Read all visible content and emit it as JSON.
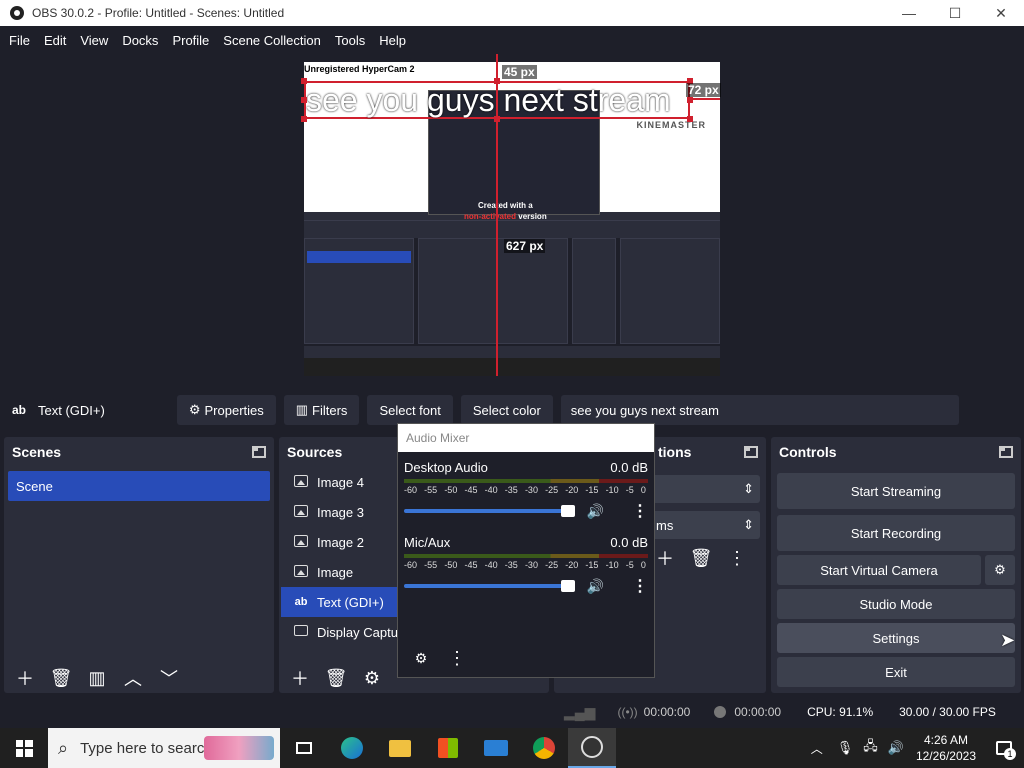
{
  "window": {
    "title": "OBS 30.0.2 - Profile: Untitled - Scenes: Untitled",
    "minimize": "—",
    "maximize": "☐",
    "close": "✕"
  },
  "menu": [
    "File",
    "Edit",
    "View",
    "Docks",
    "Profile",
    "Scene Collection",
    "Tools",
    "Help"
  ],
  "preview": {
    "overlay_text": "see you guys next stream",
    "watermark": "Unregistered HyperCam 2",
    "kinemaster": "KINEMASTER",
    "created_line1": "Created with a",
    "created_line2": "non-activated",
    "created_line3": "version",
    "label_top": "45 px",
    "label_right": "72 px",
    "label_bottom": "627 px"
  },
  "source_toolbar": {
    "icon": "ab",
    "source_name": "Text (GDI+)",
    "properties": "Properties",
    "filters": "Filters",
    "select_font": "Select font",
    "select_color": "Select color",
    "text_value": "see you guys next stream"
  },
  "scenes": {
    "title": "Scenes",
    "items": [
      "Scene"
    ]
  },
  "sources": {
    "title": "Sources",
    "items": [
      "Image 4",
      "Image 3",
      "Image 2",
      "Image",
      "Text (GDI+)",
      "Display Captur"
    ]
  },
  "transitions": {
    "title_partial": "tions",
    "field_partial": "ms"
  },
  "audio_mixer": {
    "title": "Audio Mixer",
    "channels": [
      {
        "name": "Desktop Audio",
        "db": "0.0 dB"
      },
      {
        "name": "Mic/Aux",
        "db": "0.0 dB"
      }
    ],
    "scale": [
      "-60",
      "-55",
      "-50",
      "-45",
      "-40",
      "-35",
      "-30",
      "-25",
      "-20",
      "-15",
      "-10",
      "-5",
      "0"
    ]
  },
  "controls": {
    "title": "Controls",
    "start_streaming": "Start Streaming",
    "start_recording": "Start Recording",
    "start_virtual_camera": "Start Virtual Camera",
    "studio_mode": "Studio Mode",
    "settings": "Settings",
    "exit": "Exit"
  },
  "status": {
    "stream_time": "00:00:00",
    "rec_time": "00:00:00",
    "cpu": "CPU: 91.1%",
    "fps": "30.00 / 30.00 FPS"
  },
  "taskbar": {
    "search_placeholder": "Type here to search",
    "time": "4:26 AM",
    "date": "12/26/2023",
    "notif_count": "1"
  },
  "colors": {
    "accent": "#284cb8",
    "selection": "#d0202e",
    "panel": "#2b2d3a",
    "background": "#1e1f29"
  }
}
